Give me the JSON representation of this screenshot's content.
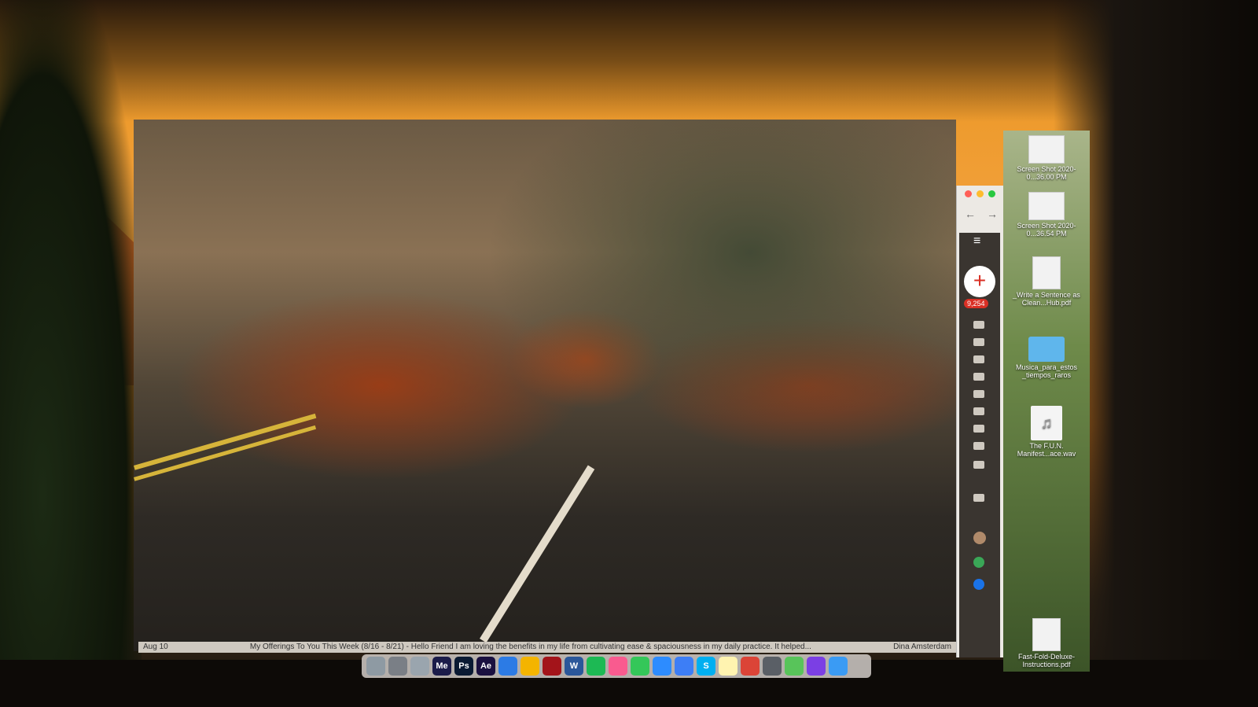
{
  "caption": {
    "left": "Aug 10",
    "text": "My Offerings To You This Week (8/16 - 8/21) - Hello Friend I am loving the benefits in my life from cultivating ease & spaciousness in my daily practice. It helped...",
    "sender": "Dina Amsterdam"
  },
  "gmail": {
    "unread_badge": "9,254",
    "compose_icon": "plus-icon"
  },
  "desktop_files": [
    {
      "label": "Screen Shot 2020-0...36.00 PM",
      "type": "screenshot"
    },
    {
      "label": "Screen Shot 2020-0...36.54 PM",
      "type": "screenshot"
    },
    {
      "label": "_Write a Sentence as Clean...Hub.pdf",
      "type": "pdf"
    },
    {
      "label": "Musica_para_estos _tiempos_raros",
      "type": "folder"
    },
    {
      "label": "The F.U.N. Manifest...ace.wav",
      "type": "audio"
    },
    {
      "label": "Fast-Fold-Deluxe-Instructions.pdf",
      "type": "pdf"
    }
  ],
  "dock": {
    "apps": [
      {
        "name": "trash",
        "label": "",
        "color": "#8e9aa3"
      },
      {
        "name": "system-preferences",
        "label": "",
        "color": "#7a7f86"
      },
      {
        "name": "preview",
        "label": "",
        "color": "#9aa5ae"
      },
      {
        "name": "media-encoder",
        "label": "Me",
        "color": "#1b1c4a"
      },
      {
        "name": "photoshop",
        "label": "Ps",
        "color": "#0a1a33"
      },
      {
        "name": "after-effects",
        "label": "Ae",
        "color": "#1a1040"
      },
      {
        "name": "safari",
        "label": "",
        "color": "#2c7be5"
      },
      {
        "name": "photos",
        "label": "",
        "color": "#f4b400"
      },
      {
        "name": "acrobat",
        "label": "",
        "color": "#a3141a"
      },
      {
        "name": "word",
        "label": "W",
        "color": "#2b579a"
      },
      {
        "name": "spotify",
        "label": "",
        "color": "#1db954"
      },
      {
        "name": "itunes",
        "label": "",
        "color": "#f95b8f"
      },
      {
        "name": "messages",
        "label": "",
        "color": "#34c759"
      },
      {
        "name": "zoom",
        "label": "",
        "color": "#2d8cff"
      },
      {
        "name": "chat",
        "label": "",
        "color": "#3d7ef6"
      },
      {
        "name": "skype",
        "label": "S",
        "color": "#00aff0"
      },
      {
        "name": "notes",
        "label": "",
        "color": "#fff3b0"
      },
      {
        "name": "chrome",
        "label": "",
        "color": "#db4437"
      },
      {
        "name": "launchpad",
        "label": "",
        "color": "#5a5f66"
      },
      {
        "name": "maps",
        "label": "",
        "color": "#58c45a"
      },
      {
        "name": "siri",
        "label": "",
        "color": "#7b3fe4"
      },
      {
        "name": "finder",
        "label": "",
        "color": "#3a9bf4"
      }
    ]
  }
}
